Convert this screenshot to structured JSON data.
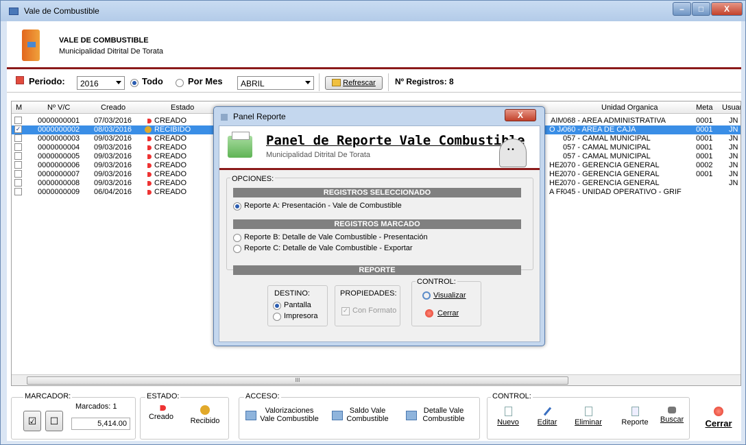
{
  "window": {
    "title": "Vale de Combustible",
    "min": "–",
    "max": "□",
    "close": "X"
  },
  "header": {
    "title": "VALE DE COMBUSTIBLE",
    "subtitle": "Municipalidad Ditrital De Torata"
  },
  "toolbar": {
    "periodo_label": "Periodo:",
    "periodo_value": "2016",
    "todo_label": "Todo",
    "pormes_label": "Por Mes",
    "mes_value": "ABRIL",
    "refrescar_label": "Refrescar",
    "registros_label": "Nº Registros: 8"
  },
  "grid": {
    "columns": {
      "m": "M",
      "nvc": "Nº V/C",
      "creado": "Creado",
      "estado": "Estado",
      "unidad": "Unidad Organica",
      "meta": "Meta",
      "usuario": "Usuar"
    },
    "rows": [
      {
        "checked": "",
        "nvc": "0000000001",
        "fecha": "07/03/2016",
        "estado": "CREADO",
        "frag": "AIM",
        "unidad": "068 - AREA ADMINISTRATIVA",
        "meta": "0001",
        "usuario": "JN"
      },
      {
        "checked": "✓",
        "nvc": "0000000002",
        "fecha": "08/03/2016",
        "estado": "RECIBIDO",
        "frag": "O JA",
        "unidad": "060 - AREA DE CAJA",
        "meta": "0001",
        "usuario": "JN"
      },
      {
        "checked": "",
        "nvc": "0000000003",
        "fecha": "09/03/2016",
        "estado": "CREADO",
        "frag": "",
        "unidad": "057 - CAMAL MUNICIPAL",
        "meta": "0001",
        "usuario": "JN"
      },
      {
        "checked": "",
        "nvc": "0000000004",
        "fecha": "09/03/2016",
        "estado": "CREADO",
        "frag": "",
        "unidad": "057 - CAMAL MUNICIPAL",
        "meta": "0001",
        "usuario": "JN"
      },
      {
        "checked": "",
        "nvc": "0000000005",
        "fecha": "09/03/2016",
        "estado": "CREADO",
        "frag": "",
        "unidad": "057 - CAMAL MUNICIPAL",
        "meta": "0001",
        "usuario": "JN"
      },
      {
        "checked": "",
        "nvc": "0000000006",
        "fecha": "09/03/2016",
        "estado": "CREADO",
        "frag": "HEZ",
        "unidad": "070 - GERENCIA GENERAL",
        "meta": "0002",
        "usuario": "JN"
      },
      {
        "checked": "",
        "nvc": "0000000007",
        "fecha": "09/03/2016",
        "estado": "CREADO",
        "frag": "HEZ",
        "unidad": "070 - GERENCIA GENERAL",
        "meta": "0001",
        "usuario": "JN"
      },
      {
        "checked": "",
        "nvc": "0000000008",
        "fecha": "09/03/2016",
        "estado": "CREADO",
        "frag": "HEZ",
        "unidad": "070 - GERENCIA GENERAL",
        "meta": "",
        "usuario": "JN"
      },
      {
        "checked": "",
        "nvc": "0000000009",
        "fecha": "06/04/2016",
        "estado": "CREADO",
        "frag": "A FR",
        "unidad": "045 - UNIDAD OPERATIVO - GRIF",
        "meta": "",
        "usuario": ""
      }
    ],
    "scroll_thumb": "III"
  },
  "footer": {
    "marcador_label": "MARCADOR:",
    "marcados_label": "Marcados: 1",
    "check_glyph": "☑",
    "uncheck_glyph": "☐",
    "total": "5,414.00",
    "estado_label": "ESTADO:",
    "creado_btn": "Creado",
    "recibido_btn": "Recibido",
    "acceso_label": "ACCESO:",
    "valorizaciones_1": "Valorizaciones",
    "valorizaciones_2": "Vale Combustible",
    "saldo_1": "Saldo Vale",
    "saldo_2": "Combustible",
    "detalle_1": "Detalle Vale",
    "detalle_2": "Combustible",
    "control_label": "CONTROL:",
    "nuevo": "Nuevo",
    "editar": "Editar",
    "eliminar": "Eliminar",
    "reporte": "Reporte",
    "buscar": "Buscar",
    "cerrar": "Cerrar"
  },
  "modal": {
    "title": "Panel Reporte",
    "close": "X",
    "heading": "Panel de Reporte Vale Combustible",
    "subtitle": "Municipalidad Ditrital De Torata",
    "opciones_label": "OPCIONES:",
    "bar_seleccionado": "REGISTROS SELECCIONADO",
    "opt_a": "Reporte A: Presentación - Vale de Combustible",
    "bar_marcado": "REGISTROS MARCADO",
    "opt_b": "Reporte B: Detalle de Vale Combustible - Presentación",
    "opt_c": "Reporte C: Detalle de Vale Combustible - Exportar",
    "bar_reporte": "REPORTE",
    "destino_label": "DESTINO:",
    "pantalla": "Pantalla",
    "impresora": "Impresora",
    "propiedades_label": "PROPIEDADES:",
    "con_formato": "Con Formato",
    "control_label": "CONTROL:",
    "visualizar": "Visualizar",
    "cerrar": "Cerrar"
  }
}
